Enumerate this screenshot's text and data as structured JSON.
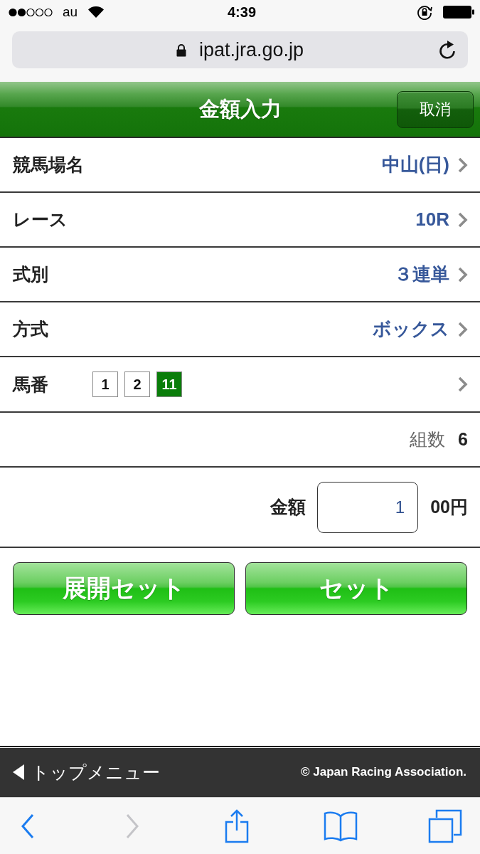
{
  "status_bar": {
    "carrier": "au",
    "time": "4:39"
  },
  "address_bar": {
    "url": "ipat.jra.go.jp"
  },
  "header": {
    "title": "金額入力",
    "cancel_button": "取消"
  },
  "rows": [
    {
      "kind": "value",
      "label": "競馬場名",
      "value": "中山(日)"
    },
    {
      "kind": "value",
      "label": "レース",
      "value": "10R"
    },
    {
      "kind": "value",
      "label": "式別",
      "value": "３連単"
    },
    {
      "kind": "value",
      "label": "方式",
      "value": "ボックス"
    },
    {
      "kind": "horses",
      "label": "馬番",
      "horses": [
        {
          "number": "1",
          "selected": false
        },
        {
          "number": "2",
          "selected": false
        },
        {
          "number": "11",
          "selected": true
        }
      ]
    }
  ],
  "combinations": {
    "label": "組数",
    "value": "6"
  },
  "amount": {
    "label": "金額",
    "value": "1",
    "unit": "00円"
  },
  "buttons": [
    "展開セット",
    "セット"
  ],
  "footer": {
    "back_link": "トップメニュー",
    "copyright": "© Japan Racing Association."
  },
  "toolbar": [
    {
      "kind": "back",
      "disabled": false
    },
    {
      "kind": "forward",
      "disabled": true
    },
    {
      "kind": "share",
      "disabled": false
    },
    {
      "kind": "bookmarks",
      "disabled": false
    },
    {
      "kind": "tabs",
      "disabled": false
    }
  ]
}
